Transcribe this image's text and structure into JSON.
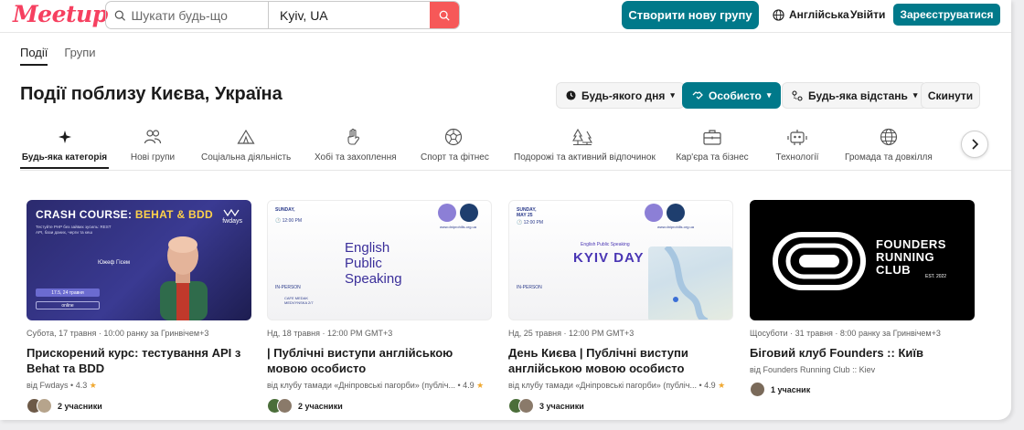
{
  "header": {
    "logo": "Meetup",
    "search_placeholder": "Шукати будь-що",
    "location_value": "Kyiv, UA",
    "create_group_label": "Створити нову групу",
    "language_label": "Англійська",
    "login_label": "Увійти",
    "register_label": "Зареєструватися"
  },
  "tabs": [
    {
      "label": "Події",
      "active": true
    },
    {
      "label": "Групи",
      "active": false
    }
  ],
  "page_title": "Події поблизу Києва, Україна",
  "filters": {
    "date": "Будь-якого дня",
    "type": "Особисто",
    "distance": "Будь-яка відстань",
    "reset": "Скинути"
  },
  "categories": [
    {
      "label": "Будь-яка категорія",
      "icon": "sparkle-icon",
      "active": true
    },
    {
      "label": "Нові групи",
      "icon": "people-icon"
    },
    {
      "label": "Соціальна діяльність",
      "icon": "tent-icon"
    },
    {
      "label": "Хобі та захоплення",
      "icon": "hand-icon"
    },
    {
      "label": "Спорт та фітнес",
      "icon": "ball-icon"
    },
    {
      "label": "Подорожі та активний відпочинок",
      "icon": "trees-icon"
    },
    {
      "label": "Кар'єра та бізнес",
      "icon": "briefcase-icon"
    },
    {
      "label": "Технології",
      "icon": "robot-icon"
    },
    {
      "label": "Громада та довкілля",
      "icon": "globe-icon"
    }
  ],
  "events": [
    {
      "meta": "Субота, 17 травня · 10:00 ранку за Гринвічем+3",
      "title": "Прискорений курс: тестування API з Behat та BDD",
      "host": "від Fwdays",
      "rating": "4.3",
      "attendees": "2 учасники",
      "thumb": {
        "headline_a": "CRASH COURSE: ",
        "headline_b": "BEHAT & BDD",
        "subtitle": "Тестуйте PHP без зайвих зусиль: REST API, бази даних, черги та кеш",
        "brand": "fwdays",
        "speaker": "Южеф Гісем",
        "date": "17.5, 24 травня",
        "online": "online"
      }
    },
    {
      "meta": "Нд, 18 травня · 12:00 PM GMT+3",
      "title": "| Публічні виступи англійською мовою особисто",
      "host": "від клубу тамади «Дніпровські пагорби» (публіч...",
      "rating": "4.9",
      "attendees": "2 учасники",
      "thumb": {
        "day": "SUNDAY,",
        "time": "12:00 PM",
        "line1": "English",
        "line2": "Public",
        "line3": "Speaking",
        "in_person": "IN-PERSON",
        "cafe": "CAFE MEDAK",
        "street": "MEDVYNSKA 2/7",
        "site": "www.dniprohills.org.ua"
      }
    },
    {
      "meta": "Нд, 25 травня · 12:00 PM GMT+3",
      "title": "День Києва | Публічні виступи англійською мовою особисто",
      "host": "від клубу тамади «Дніпровські пагорби» (публіч...",
      "rating": "4.9",
      "attendees": "3 учасники",
      "thumb": {
        "day": "SUNDAY,",
        "date": "MAY 25",
        "time": "12:00 PM",
        "tag": "English Public Speaking",
        "headline": "KYIV  DAY",
        "in_person": "IN-PERSON",
        "site": "www.dniprohills.org.ua"
      }
    },
    {
      "meta": "Щосуботи · 31 травня · 8:00 ранку за Гринвічем+3",
      "title": "Біговий клуб Founders :: Київ",
      "host": "від Founders Running Club :: Kiev",
      "rating": "",
      "attendees": "1 учасник",
      "thumb": {
        "l1": "FOUNDERS",
        "l2": "RUNNING",
        "l3": "CLUB",
        "est": "EST. 2022"
      }
    }
  ],
  "colors": {
    "brand": "#f64060",
    "teal": "#00798a",
    "search_red": "#f65858"
  }
}
